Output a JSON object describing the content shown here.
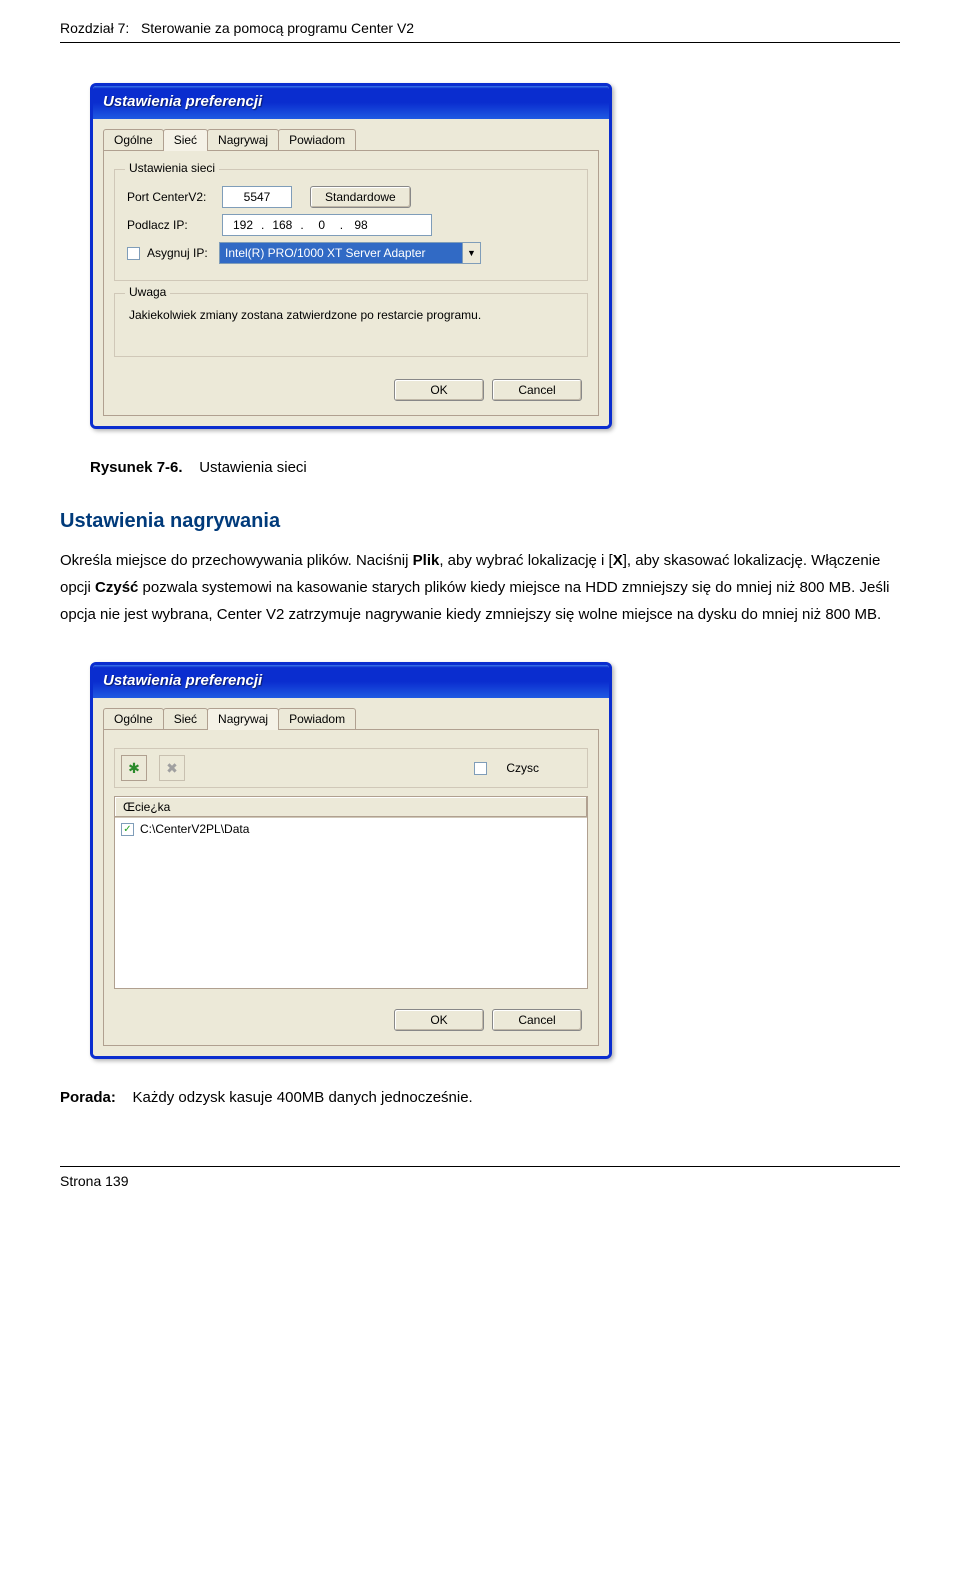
{
  "chapter": {
    "prefix": "Rozdział 7:",
    "title": "Sterowanie za pomocą programu Center V2"
  },
  "dialog1": {
    "title": "Ustawienia preferencji",
    "tabs": [
      "Ogólne",
      "Sieć",
      "Nagrywaj",
      "Powiadom"
    ],
    "active_tab_index": 1,
    "network": {
      "legend": "Ustawienia sieci",
      "port_label": "Port CenterV2:",
      "port_value": "5547",
      "default_btn": "Standardowe",
      "ip_label": "Podlacz IP:",
      "ip_segs": [
        "192",
        "168",
        "0",
        "98"
      ],
      "assign_label": "Asygnuj IP:",
      "adapter_value": "Intel(R) PRO/1000 XT Server Adapter"
    },
    "note": {
      "legend": "Uwaga",
      "text": "Jakiekolwiek zmiany zostana zatwierdzone po restarcie programu."
    },
    "ok": "OK",
    "cancel": "Cancel"
  },
  "figure": {
    "label": "Rysunek 7-6.",
    "caption": "Ustawienia sieci"
  },
  "section_heading": "Ustawienia nagrywania",
  "paragraph": {
    "p1_a": "Określa miejsce do przechowywania plików. Naciśnij ",
    "p1_b1": "Plik",
    "p1_c": ", aby wybrać lokalizację i [",
    "p1_b2": "X",
    "p1_d": "], aby skasować lokalizację. Włączenie opcji ",
    "p1_b3": "Czyść",
    "p1_e": " pozwala systemowi na kasowanie starych plików kiedy miejsce na HDD zmniejszy się do mniej niż 800 MB. Jeśli opcja nie jest wybrana, Center V2 zatrzymuje nagrywanie kiedy zmniejszy się wolne miejsce na dysku do mniej niż 800 MB."
  },
  "dialog2": {
    "title": "Ustawienia preferencji",
    "tabs": [
      "Ogólne",
      "Sieć",
      "Nagrywaj",
      "Powiadom"
    ],
    "active_tab_index": 2,
    "toolbar": {
      "add_icon": "✱",
      "del_icon": "✖",
      "recycle_label": "Czysc"
    },
    "list": {
      "header": "Œcie¿ka",
      "row1_path": "C:\\CenterV2PL\\Data",
      "row1_check": "✓"
    },
    "ok": "OK",
    "cancel": "Cancel"
  },
  "tip": {
    "label": "Porada:",
    "text": "Każdy odzysk kasuje 400MB danych jednocześnie."
  },
  "footer": {
    "page": "Strona 139"
  }
}
